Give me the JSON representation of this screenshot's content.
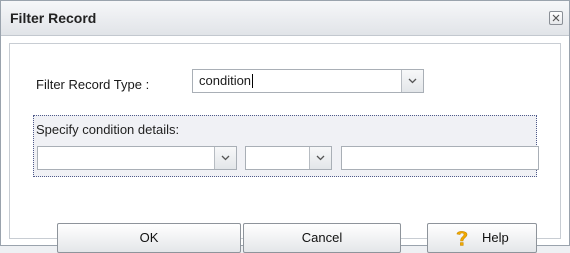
{
  "dialog": {
    "title": "Filter Record",
    "close_icon": "close-icon"
  },
  "form": {
    "type_label": "Filter Record Type :",
    "type_value": "condition",
    "details_legend": "Specify condition details:",
    "field_select_value": "",
    "operator_select_value": "",
    "condition_value": ""
  },
  "buttons": {
    "ok": "OK",
    "cancel": "Cancel",
    "help": "Help",
    "help_icon": "question-mark-icon"
  },
  "colors": {
    "accent": "#f2a900",
    "border": "#a9afb6"
  }
}
